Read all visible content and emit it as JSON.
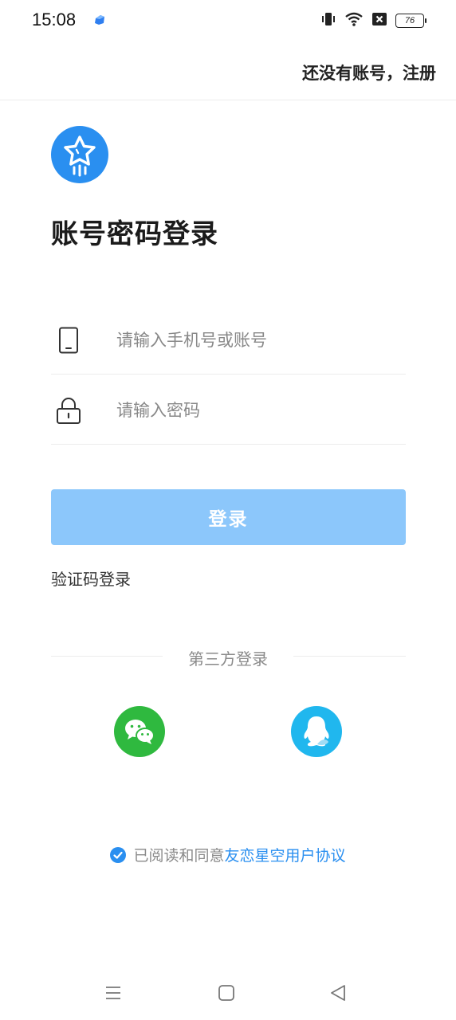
{
  "status_bar": {
    "time": "15:08",
    "battery": "76",
    "icons": [
      "app-notification-icon",
      "vibrate-icon",
      "wifi-icon",
      "sim-blocked-icon",
      "battery-icon"
    ]
  },
  "header": {
    "register_link": "还没有账号，注册"
  },
  "logo_icon": "star-rocket-logo-icon",
  "page_title": "账号密码登录",
  "form": {
    "phone_placeholder": "请输入手机号或账号",
    "phone_icon": "phone-icon",
    "password_placeholder": "请输入密码",
    "password_icon": "lock-icon",
    "login_button": "登录",
    "sms_login_link": "验证码登录"
  },
  "third_party": {
    "label": "第三方登录",
    "providers": [
      "wechat-icon",
      "qq-icon"
    ]
  },
  "agreement": {
    "prefix": "已阅读和同意",
    "link": "友恋星空用户协议",
    "checked": true
  },
  "nav_bar": {
    "icons": [
      "menu-icon",
      "home-icon",
      "back-icon"
    ]
  },
  "colors": {
    "accent": "#2a8ff0",
    "login_button_disabled": "#8cc7fb",
    "wechat": "#2fb93f",
    "qq": "#20b7ee",
    "muted_text": "#8a8a8a"
  }
}
